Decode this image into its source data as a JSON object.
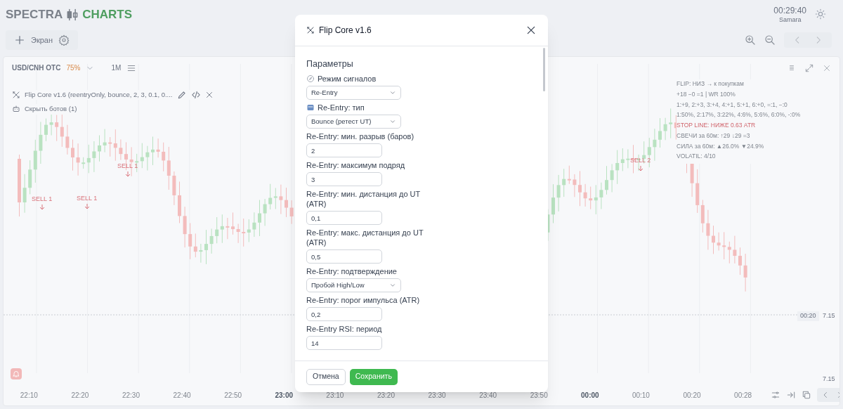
{
  "header": {
    "logo_left": "SPECTRA",
    "logo_right": "CHARTS",
    "clock": "00:29:40",
    "timezone": "Samara"
  },
  "toolbar": {
    "add_screen": "Экран"
  },
  "chart_panel": {
    "symbol": "USD/CNH OTC",
    "payout": "75%",
    "timeframe": "1M",
    "indicator": "Flip Core v1.6 (reentryOnly, bounce, 2, 3, 0.1, 0....",
    "hide_bots": "Скрыть ботов (1)",
    "signals": [
      {
        "label": "SELL 1"
      },
      {
        "label": "SELL 1"
      },
      {
        "label": "SELL 1"
      },
      {
        "label": "SELL 2"
      }
    ],
    "info_lines": [
      {
        "text": "FLIP: НИЗ → к покупкам",
        "alert": false
      },
      {
        "text": "+18 −0 =1 | WR 100%",
        "alert": false
      },
      {
        "text": "1:+9, 2:+3, 3:+4, 4:+1, 5:+1, 6:+0, =:1, −:0",
        "alert": false
      },
      {
        "text": "1:50%, 2:17%, 3:22%, 4:6%, 5:6%, 6:0%, -:0%",
        "alert": false
      },
      {
        "text": "STOP LINE: НИЖЕ 0.63 ATR",
        "alert": true
      },
      {
        "text": "СВЕЧИ за 60м: ↑29 ↓29 =3",
        "alert": false
      },
      {
        "text": "СИЛА за 60м: ▲26.0% ▼24.9%",
        "alert": false
      },
      {
        "text": "VOLATIL: 4/10",
        "alert": false
      }
    ],
    "timer_label": "00:20",
    "price_labels": [
      "7.15",
      "7.15"
    ],
    "time_axis": [
      {
        "label": "22:10",
        "major": false
      },
      {
        "label": "22:20",
        "major": false
      },
      {
        "label": "22:30",
        "major": false
      },
      {
        "label": "22:40",
        "major": false
      },
      {
        "label": "22:50",
        "major": false
      },
      {
        "label": "23:00",
        "major": true
      },
      {
        "label": "23:10",
        "major": false
      },
      {
        "label": "23:20",
        "major": false
      },
      {
        "label": "23:30",
        "major": false
      },
      {
        "label": "23:40",
        "major": false
      },
      {
        "label": "23:50",
        "major": false
      },
      {
        "label": "00:00",
        "major": true
      },
      {
        "label": "00:10",
        "major": false
      },
      {
        "label": "00:20",
        "major": false
      },
      {
        "label": "00:28",
        "major": false
      }
    ]
  },
  "dialog": {
    "title": "Flip Core v1.6",
    "section": "Параметры",
    "fields": [
      {
        "kind": "select",
        "label": "Режим сигналов",
        "value": "Re-Entry"
      },
      {
        "kind": "select",
        "label": "Re-Entry: тип",
        "value": "Bounce (ретест UT)"
      },
      {
        "kind": "number",
        "label": "Re-Entry: мин. разрыв (баров)",
        "value": "2"
      },
      {
        "kind": "number",
        "label": "Re-Entry: максимум подряд",
        "value": "3"
      },
      {
        "kind": "number",
        "label": "Re-Entry: мин. дистанция до UT (ATR)",
        "value": "0,1"
      },
      {
        "kind": "number",
        "label": "Re-Entry: макс. дистанция до UT (ATR)",
        "value": "0,5"
      },
      {
        "kind": "select",
        "label": "Re-Entry: подтверждение",
        "value": "Пробой High/Low"
      },
      {
        "kind": "number",
        "label": "Re-Entry: порог импульса (ATR)",
        "value": "0,2"
      },
      {
        "kind": "number",
        "label": "Re-Entry RSI: период",
        "value": "14"
      }
    ],
    "cancel": "Отмена",
    "save": "Сохранить"
  }
}
